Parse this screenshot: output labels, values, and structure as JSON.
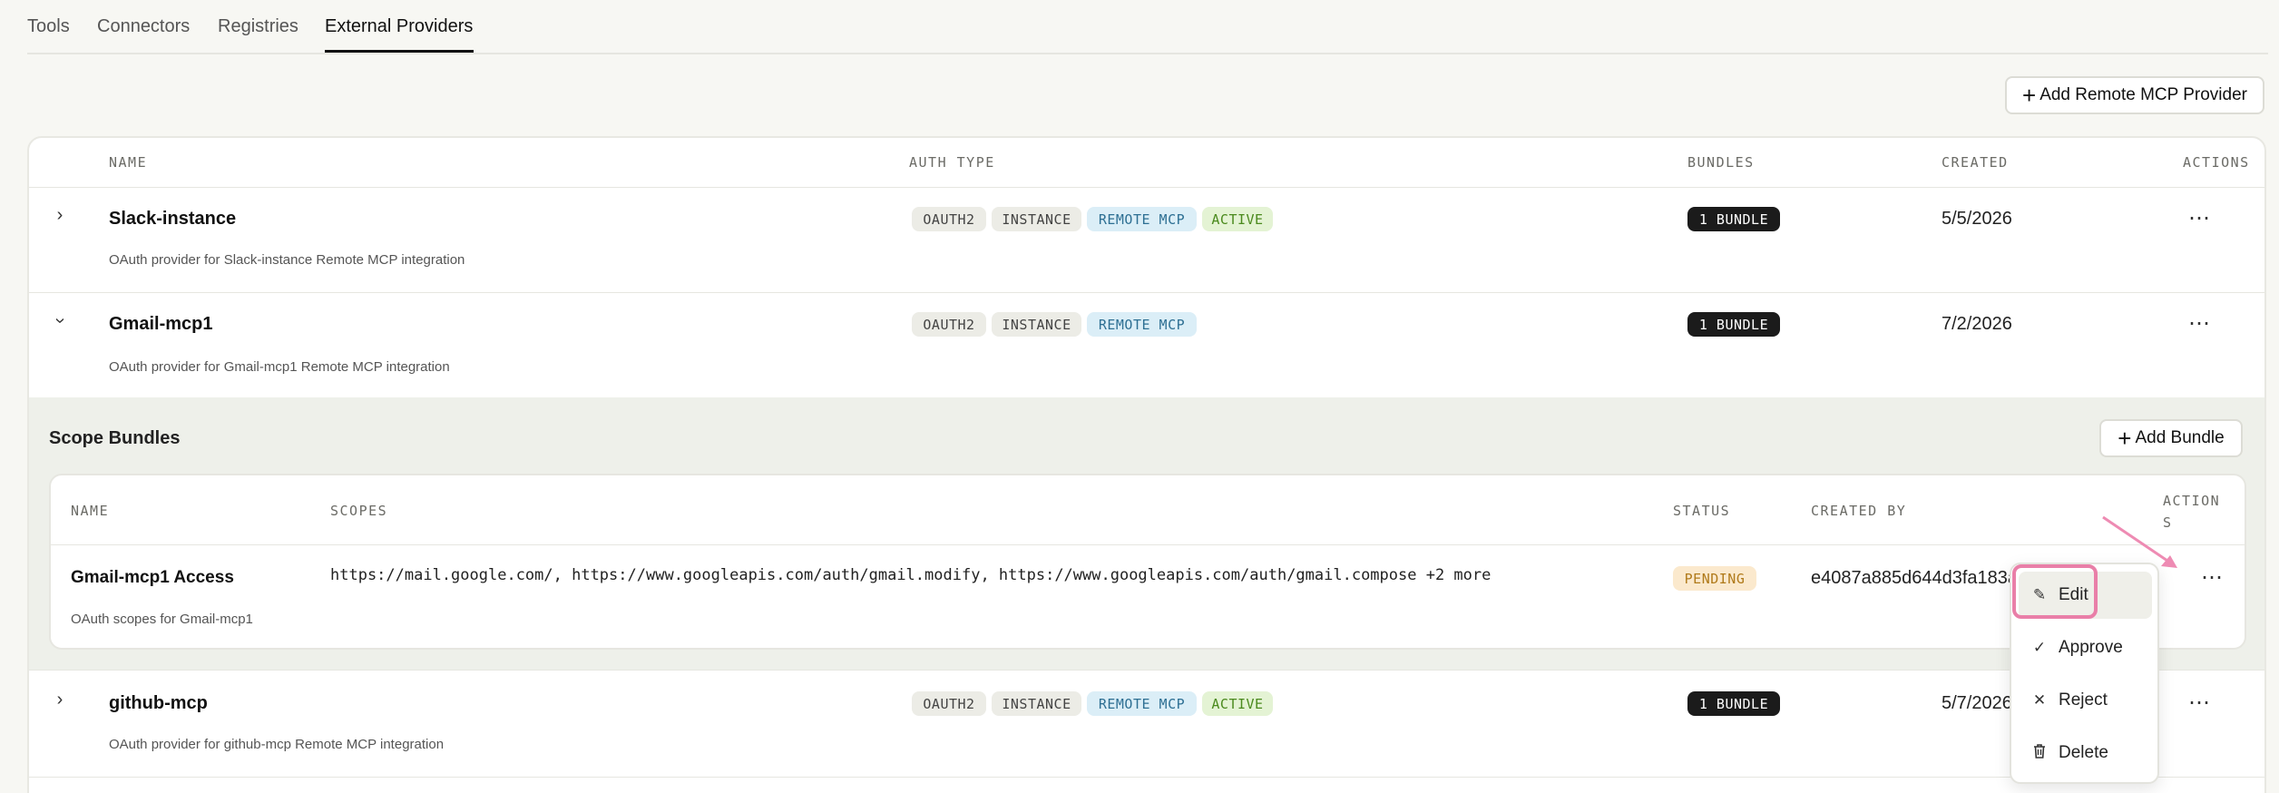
{
  "tabs": [
    {
      "label": "Tools"
    },
    {
      "label": "Connectors"
    },
    {
      "label": "Registries"
    },
    {
      "label": "External Providers",
      "active": true
    }
  ],
  "add_provider_label": "Add Remote MCP Provider",
  "table": {
    "headers": {
      "name": "NAME",
      "auth_type": "AUTH TYPE",
      "bundles": "BUNDLES",
      "created": "CREATED",
      "actions": "ACTIONS"
    }
  },
  "providers": [
    {
      "name": "Slack-instance",
      "description": "OAuth provider for Slack-instance Remote MCP integration",
      "tags": [
        "OAUTH2",
        "INSTANCE",
        "REMOTE MCP",
        "ACTIVE"
      ],
      "bundles": "1 BUNDLE",
      "created": "5/5/2026",
      "expanded": false
    },
    {
      "name": "Gmail-mcp1",
      "description": "OAuth provider for Gmail-mcp1 Remote MCP integration",
      "tags": [
        "OAUTH2",
        "INSTANCE",
        "REMOTE MCP"
      ],
      "bundles": "1 BUNDLE",
      "created": "7/2/2026",
      "expanded": true
    },
    {
      "name": "github-mcp",
      "description": "OAuth provider for github-mcp Remote MCP integration",
      "tags": [
        "OAUTH2",
        "INSTANCE",
        "REMOTE MCP",
        "ACTIVE"
      ],
      "bundles": "1 BUNDLE",
      "created": "5/7/2026",
      "expanded": false
    }
  ],
  "scope_bundles": {
    "title": "Scope Bundles",
    "add_label": "Add Bundle",
    "headers": {
      "name": "NAME",
      "scopes": "SCOPES",
      "status": "STATUS",
      "created_by": "CREATED BY",
      "actions": "ACTION S"
    },
    "rows": [
      {
        "name": "Gmail-mcp1 Access",
        "description": "OAuth scopes for Gmail-mcp1",
        "scopes": "https://mail.google.com/, https://www.googleapis.com/auth/gmail.modify, https://www.googleapis.com/auth/gmail.compose +2 more",
        "status": "PENDING",
        "created_by": "e4087a885d644d3fa183a78e"
      }
    ]
  },
  "menu": {
    "items": [
      {
        "label": "Edit",
        "icon": "pencil-icon"
      },
      {
        "label": "Approve",
        "icon": "check-icon"
      },
      {
        "label": "Reject",
        "icon": "x-icon"
      },
      {
        "label": "Delete",
        "icon": "trash-icon"
      }
    ]
  },
  "colors": {
    "accent_highlight": "#e97fa8",
    "pending": "#b07a1a",
    "active": "#4b8a1e",
    "remote_mcp": "#2d6f93"
  }
}
